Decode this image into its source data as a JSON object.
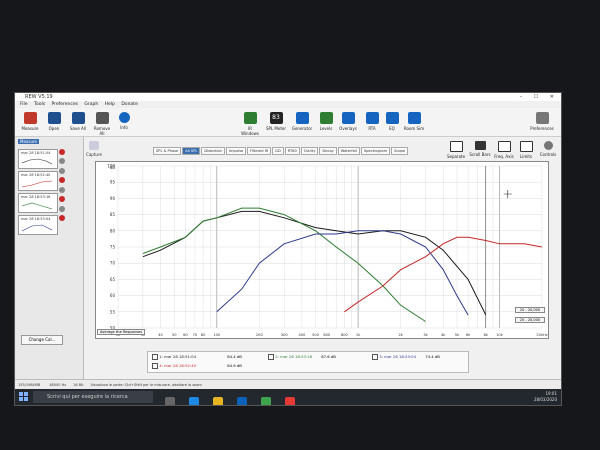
{
  "window": {
    "title": "REW V5.19",
    "controls": "– ☐ ✕"
  },
  "menu": [
    "File",
    "Tools",
    "Preferences",
    "Graph",
    "Help",
    "Donate"
  ],
  "toolbar_left": [
    {
      "label": "Measure",
      "color": "#c0392b"
    },
    {
      "label": "Open",
      "color": "#1f4f8f"
    },
    {
      "label": "Save All",
      "color": "#1f4f8f"
    },
    {
      "label": "Remove All",
      "color": "#555555"
    },
    {
      "label": "Info",
      "color": "#1565c0"
    }
  ],
  "toolbar_center": [
    {
      "label": "IR Windows",
      "color": "#2e7d32"
    },
    {
      "label": "SPL Meter",
      "color": "#222222",
      "value": "83"
    },
    {
      "label": "Generator",
      "color": "#1565c0"
    },
    {
      "label": "Levels",
      "color": "#2e7d32"
    },
    {
      "label": "Overlays",
      "color": "#1565c0"
    },
    {
      "label": "RTA",
      "color": "#1565c0"
    },
    {
      "label": "EQ",
      "color": "#1565c0"
    },
    {
      "label": "Room Sim",
      "color": "#1565c0"
    }
  ],
  "toolbar_right": {
    "label": "Preferences"
  },
  "left_panel": {
    "tab": "Measure",
    "measurements": [
      {
        "label": "mar 28 18:51:04"
      },
      {
        "label": "mar 28 18:52:40"
      },
      {
        "label": "mar 28 18:53:16"
      },
      {
        "label": "mar 28 18:53:04"
      }
    ],
    "change_button": "Change Cal..."
  },
  "capture": {
    "label": "Capture"
  },
  "graph_tabs": [
    "SPL & Phase",
    "All SPL",
    "Distortion",
    "Impulse",
    "Filtered IR",
    "GD",
    "RT60",
    "Clarity",
    "Decay",
    "Waterfall",
    "Spectrogram",
    "Scope"
  ],
  "active_tab": "All SPL",
  "right_tools": [
    "Separate",
    "Scroll Bars",
    "Freq. Axis",
    "Limits",
    "Controls"
  ],
  "average_button": "Average the Responses",
  "ranges": [
    "20 - 20,000",
    "20 - 20,000"
  ],
  "chart_data": {
    "type": "line",
    "y_ticks": [
      "dB",
      "100",
      "95",
      "90",
      "85",
      "80",
      "75",
      "70",
      "65",
      "60",
      "55",
      "50"
    ],
    "x_ticks": [
      "Hz",
      "30",
      "40",
      "50",
      "60",
      "70",
      "80",
      "100",
      "200",
      "300",
      "400",
      "500",
      "600",
      "800",
      "1k",
      "2k",
      "3k",
      "4k",
      "5k",
      "6k",
      "8k",
      "10k",
      "20kHz"
    ],
    "ylim": [
      50,
      100
    ],
    "xlim": [
      20,
      20000
    ],
    "log_x": true,
    "grid": true,
    "cursor_hz": 8000,
    "series": [
      {
        "color": "#1b1b1b",
        "points": [
          [
            30,
            72
          ],
          [
            40,
            74
          ],
          [
            60,
            78
          ],
          [
            80,
            83
          ],
          [
            100,
            84
          ],
          [
            150,
            86
          ],
          [
            200,
            86
          ],
          [
            300,
            84
          ],
          [
            500,
            81
          ],
          [
            700,
            80
          ],
          [
            1000,
            79
          ],
          [
            1500,
            80
          ],
          [
            2000,
            80
          ],
          [
            3000,
            78
          ],
          [
            4000,
            74
          ],
          [
            6000,
            65
          ],
          [
            8000,
            54
          ]
        ]
      },
      {
        "color": "#2e7d32",
        "points": [
          [
            30,
            73
          ],
          [
            40,
            75
          ],
          [
            60,
            78
          ],
          [
            80,
            83
          ],
          [
            100,
            84
          ],
          [
            150,
            87
          ],
          [
            200,
            87
          ],
          [
            300,
            85
          ],
          [
            500,
            80
          ],
          [
            700,
            75
          ],
          [
            1000,
            70
          ],
          [
            1500,
            63
          ],
          [
            2000,
            57
          ],
          [
            3000,
            52
          ]
        ]
      },
      {
        "color": "#2e3a8c",
        "points": [
          [
            100,
            55
          ],
          [
            150,
            62
          ],
          [
            200,
            70
          ],
          [
            300,
            76
          ],
          [
            500,
            79
          ],
          [
            700,
            79
          ],
          [
            1000,
            80
          ],
          [
            1500,
            80
          ],
          [
            2000,
            79
          ],
          [
            3000,
            75
          ],
          [
            4000,
            68
          ],
          [
            5000,
            60
          ],
          [
            6000,
            54
          ]
        ]
      },
      {
        "color": "#c62828",
        "points": [
          [
            800,
            55
          ],
          [
            1000,
            58
          ],
          [
            1500,
            63
          ],
          [
            2000,
            68
          ],
          [
            3000,
            72
          ],
          [
            4000,
            76
          ],
          [
            5000,
            78
          ],
          [
            6000,
            78
          ],
          [
            8000,
            77
          ],
          [
            10000,
            76
          ],
          [
            15000,
            76
          ],
          [
            20000,
            75
          ]
        ]
      }
    ]
  },
  "legend": [
    {
      "name": "1: mar 28 18:51:04",
      "color": "#1b1b1b",
      "value": "84.4 dB"
    },
    {
      "name": "2: mar 28 18:53:16",
      "color": "#2e7d32",
      "value": "87.6 dB"
    },
    {
      "name": "3: mar 28 18:53:04",
      "color": "#2e3a8c",
      "value": "74.4 dB"
    },
    {
      "name": "4: mar 28 18:52:40",
      "color": "#c62828",
      "value": "84.9 dB"
    }
  ],
  "status": {
    "left": "155/1984MB",
    "mid": "48000 Hz",
    "sr": "16 Bit",
    "msg": "Visualizza le parte: Ctrl+Shift per le misurare, adattare lo zoom"
  },
  "taskbar": {
    "search": "Scrivi qui per eseguire la ricerca",
    "time": "19:01",
    "date": "28/03/2020"
  }
}
